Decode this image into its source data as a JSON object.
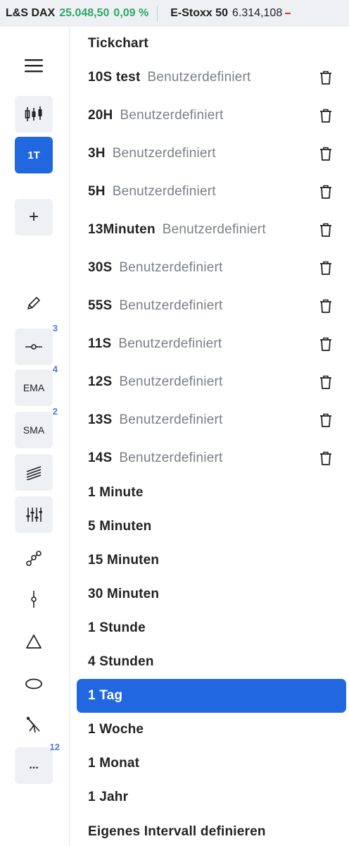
{
  "ticker": [
    {
      "name": "L&S DAX",
      "price": "25.048,50",
      "change": "0,09 %"
    },
    {
      "name": "E-Stoxx 50",
      "price": "6.314,108"
    }
  ],
  "toolbar": {
    "menu_icon": "hamburger-icon",
    "candles_icon": "candlestick-icon",
    "interval_label": "1T",
    "add_label": "+",
    "ema_label": "EMA",
    "sma_label": "SMA",
    "more_label": "...",
    "badges": {
      "line_tool": "3",
      "ema": "4",
      "sma": "2",
      "more": "12"
    }
  },
  "menu": {
    "header": "Tickchart",
    "custom_intervals": [
      {
        "label": "10S test",
        "type": "Benutzerdefiniert"
      },
      {
        "label": "20H",
        "type": "Benutzerdefiniert"
      },
      {
        "label": "3H",
        "type": "Benutzerdefiniert"
      },
      {
        "label": "5H",
        "type": "Benutzerdefiniert"
      },
      {
        "label": "13Minuten",
        "type": "Benutzerdefiniert"
      },
      {
        "label": "30S",
        "type": "Benutzerdefiniert"
      },
      {
        "label": "55S",
        "type": "Benutzerdefiniert"
      },
      {
        "label": "11S",
        "type": "Benutzerdefiniert"
      },
      {
        "label": "12S",
        "type": "Benutzerdefiniert"
      },
      {
        "label": "13S",
        "type": "Benutzerdefiniert"
      },
      {
        "label": "14S",
        "type": "Benutzerdefiniert"
      }
    ],
    "standard_intervals": [
      "1 Minute",
      "5 Minuten",
      "15 Minuten",
      "30 Minuten",
      "1 Stunde",
      "4 Stunden",
      "1 Tag",
      "1 Woche",
      "1 Monat",
      "1 Jahr"
    ],
    "selected": "1 Tag",
    "define_label": "Eigenes Intervall definieren"
  },
  "colors": {
    "accent": "#2167e0",
    "up": "#2aa86a",
    "badge": "#4b7be0"
  }
}
